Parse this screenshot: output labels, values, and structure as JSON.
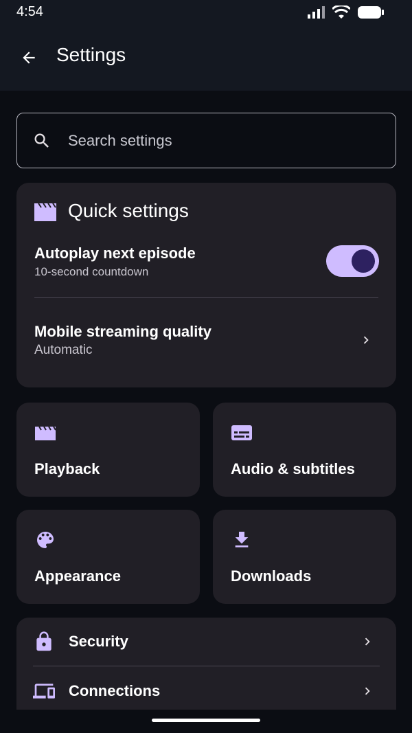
{
  "status_bar": {
    "time": "4:54",
    "icons": [
      "signal-icon",
      "wifi-icon",
      "battery-icon"
    ]
  },
  "header": {
    "title": "Settings",
    "back_icon": "arrow-back-icon"
  },
  "search": {
    "placeholder": "Search settings",
    "value": ""
  },
  "quick_settings": {
    "title": "Quick settings",
    "icon": "clapperboard-icon",
    "autoplay": {
      "title": "Autoplay next episode",
      "subtitle": "10-second countdown",
      "enabled": true
    },
    "streaming": {
      "title": "Mobile streaming quality",
      "value": "Automatic"
    }
  },
  "tiles": [
    {
      "label": "Playback",
      "icon": "clapperboard-icon"
    },
    {
      "label": "Audio & subtitles",
      "icon": "subtitles-icon"
    },
    {
      "label": "Appearance",
      "icon": "palette-icon"
    },
    {
      "label": "Downloads",
      "icon": "download-icon"
    }
  ],
  "list": [
    {
      "label": "Security",
      "icon": "lock-icon"
    },
    {
      "label": "Connections",
      "icon": "devices-icon"
    }
  ],
  "colors": {
    "accent": "#cfbcff",
    "background": "#0b0d13",
    "card": "#211f26",
    "toggle_knob": "#2d2160"
  }
}
